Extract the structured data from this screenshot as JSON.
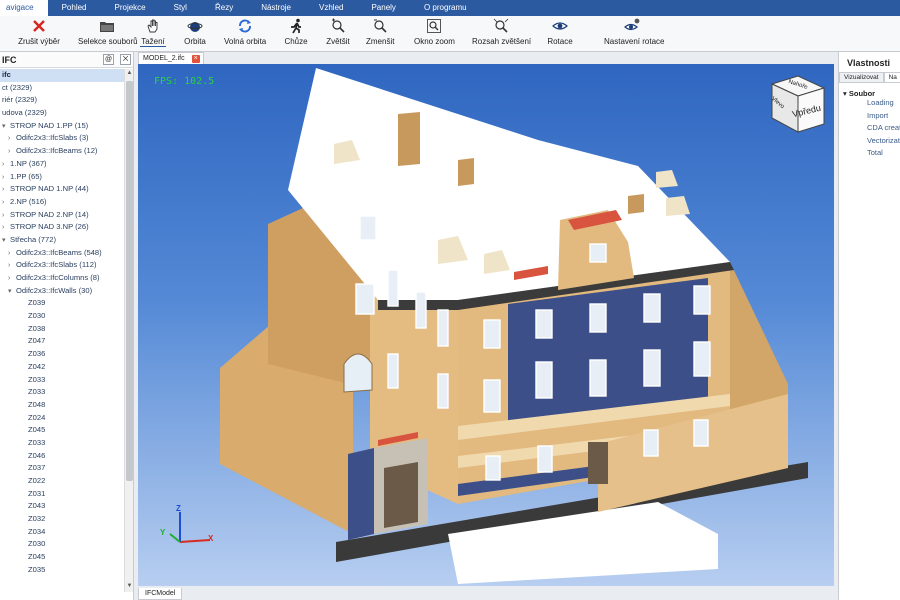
{
  "menu": [
    "avigace",
    "Pohled",
    "Projekce",
    "Styl",
    "Řezy",
    "Nástroje",
    "Vzhled",
    "Panely",
    "O programu"
  ],
  "toolbar": [
    {
      "label": "Zrušit výběr",
      "icon": "cancel-x-icon"
    },
    {
      "label": "Selekce souborů",
      "icon": "folder-icon"
    },
    {
      "label": "Tažení",
      "icon": "hand-icon"
    },
    {
      "label": "Orbita",
      "icon": "orbit-icon"
    },
    {
      "label": "Volná orbita",
      "icon": "free-orbit-icon"
    },
    {
      "label": "Chůze",
      "icon": "walk-icon"
    },
    {
      "label": "Zvětšit",
      "icon": "zoom-in-icon"
    },
    {
      "label": "Zmenšit",
      "icon": "zoom-out-icon"
    },
    {
      "label": "Okno zoom",
      "icon": "zoom-window-icon"
    },
    {
      "label": "Rozsah zvětšení",
      "icon": "zoom-extents-icon"
    },
    {
      "label": "Rotace",
      "icon": "rotate-eye-icon"
    },
    {
      "label": "Nastavení rotace",
      "icon": "rotation-settings-icon"
    }
  ],
  "left_panel": {
    "title": "IFC",
    "tree": [
      {
        "label": "ifc",
        "level": 0,
        "arrow": "",
        "root": true
      },
      {
        "label": "ct (2329)",
        "level": 0,
        "arrow": ""
      },
      {
        "label": "riér (2329)",
        "level": 0,
        "arrow": ""
      },
      {
        "label": "udova (2329)",
        "level": 0,
        "arrow": ""
      },
      {
        "label": "STROP NAD 1.PP (15)",
        "level": 0,
        "arrow": "▾"
      },
      {
        "label": "Odifc2x3::IfcSlabs (3)",
        "level": 1,
        "arrow": "›"
      },
      {
        "label": "Odifc2x3::IfcBeams (12)",
        "level": 1,
        "arrow": "›"
      },
      {
        "label": "1.NP (367)",
        "level": 0,
        "arrow": "›"
      },
      {
        "label": "1.PP (65)",
        "level": 0,
        "arrow": "›"
      },
      {
        "label": "STROP NAD 1.NP (44)",
        "level": 0,
        "arrow": "›"
      },
      {
        "label": "2.NP (516)",
        "level": 0,
        "arrow": "›"
      },
      {
        "label": "STROP NAD 2.NP (14)",
        "level": 0,
        "arrow": "›"
      },
      {
        "label": "STROP NAD 3.NP (26)",
        "level": 0,
        "arrow": "›"
      },
      {
        "label": "Střecha (772)",
        "level": 0,
        "arrow": "▾"
      },
      {
        "label": "Odifc2x3::IfcBeams (548)",
        "level": 1,
        "arrow": "›"
      },
      {
        "label": "Odifc2x3::IfcSlabs (112)",
        "level": 1,
        "arrow": "›"
      },
      {
        "label": "Odifc2x3::IfcColumns (8)",
        "level": 1,
        "arrow": "›"
      },
      {
        "label": "Odifc2x3::IfcWalls (30)",
        "level": 1,
        "arrow": "▾"
      },
      {
        "label": "Z039",
        "level": 2,
        "arrow": ""
      },
      {
        "label": "Z030",
        "level": 2,
        "arrow": ""
      },
      {
        "label": "Z038",
        "level": 2,
        "arrow": ""
      },
      {
        "label": "Z047",
        "level": 2,
        "arrow": ""
      },
      {
        "label": "Z036",
        "level": 2,
        "arrow": ""
      },
      {
        "label": "Z042",
        "level": 2,
        "arrow": ""
      },
      {
        "label": "Z033",
        "level": 2,
        "arrow": ""
      },
      {
        "label": "Z033",
        "level": 2,
        "arrow": ""
      },
      {
        "label": "Z048",
        "level": 2,
        "arrow": ""
      },
      {
        "label": "Z024",
        "level": 2,
        "arrow": ""
      },
      {
        "label": "Z045",
        "level": 2,
        "arrow": ""
      },
      {
        "label": "Z033",
        "level": 2,
        "arrow": ""
      },
      {
        "label": "Z046",
        "level": 2,
        "arrow": ""
      },
      {
        "label": "Z037",
        "level": 2,
        "arrow": ""
      },
      {
        "label": "Z022",
        "level": 2,
        "arrow": ""
      },
      {
        "label": "Z031",
        "level": 2,
        "arrow": ""
      },
      {
        "label": "Z043",
        "level": 2,
        "arrow": ""
      },
      {
        "label": "Z032",
        "level": 2,
        "arrow": ""
      },
      {
        "label": "Z034",
        "level": 2,
        "arrow": ""
      },
      {
        "label": "Z030",
        "level": 2,
        "arrow": ""
      },
      {
        "label": "Z045",
        "level": 2,
        "arrow": ""
      },
      {
        "label": "Z035",
        "level": 2,
        "arrow": ""
      }
    ]
  },
  "viewport": {
    "tab_label": "MODEL_2.ifc",
    "fps": "FPS: 102.5",
    "viewcube_front": "Vpředu",
    "viewcube_top": "Nahoře",
    "viewcube_left": "Vlevo",
    "axis_x": "X",
    "axis_y": "Y",
    "axis_z": "Z",
    "bottom_tab": "IFCModel"
  },
  "right_panel": {
    "title": "Vlastnosti",
    "tabs": [
      "Vizualizovat",
      "Na"
    ],
    "group": "Soubor",
    "items": [
      "Loading",
      "Import",
      "CDA creati",
      "Vectorizati",
      "Total"
    ]
  },
  "colors": {
    "menubar": "#2c5aa0",
    "sky_top": "#2f66c0",
    "sky_bottom": "#b7cef0",
    "facade": "#e2b97f",
    "wall_blue": "#3d4f88",
    "roof": "#ffffff",
    "fps_text": "#27d637"
  }
}
